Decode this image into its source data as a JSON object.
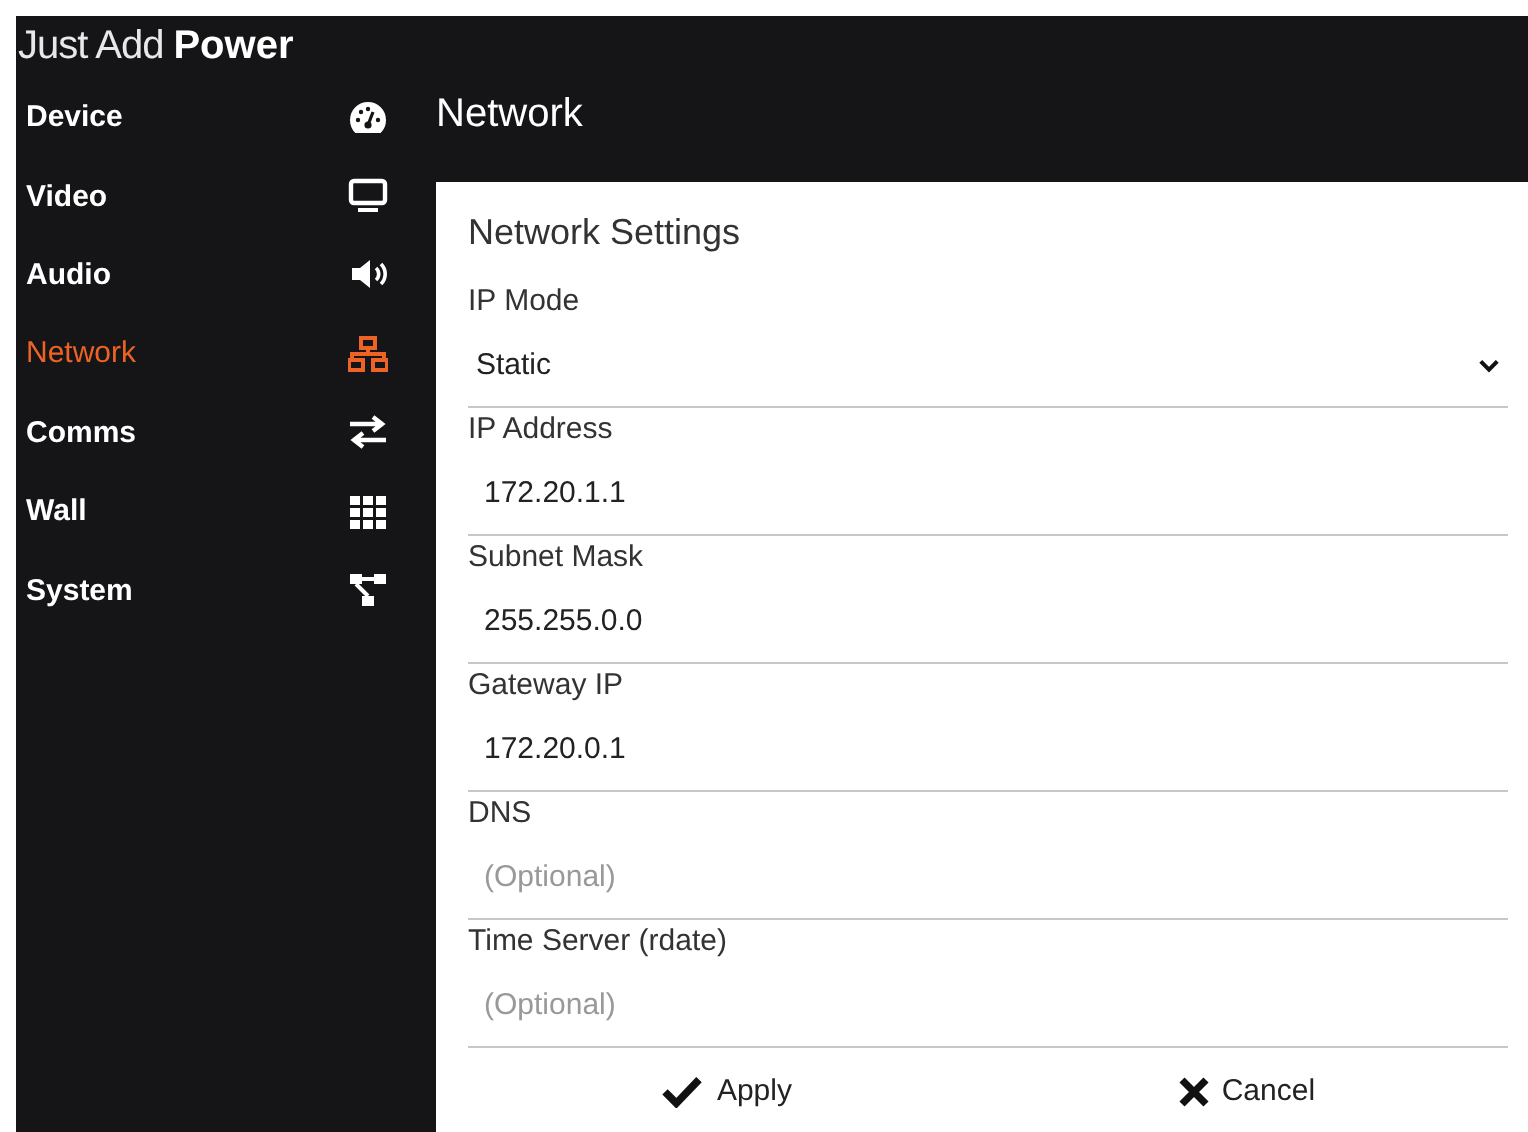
{
  "brand": {
    "light": "Just Add",
    "bold": "Power"
  },
  "sidebar": {
    "items": [
      {
        "label": "Device",
        "kind": "gauge",
        "selected": false
      },
      {
        "label": "Video",
        "kind": "monitor",
        "selected": false
      },
      {
        "label": "Audio",
        "kind": "speaker",
        "selected": false
      },
      {
        "label": "Network",
        "kind": "network",
        "selected": true
      },
      {
        "label": "Comms",
        "kind": "swap",
        "selected": false
      },
      {
        "label": "Wall",
        "kind": "grid",
        "selected": false
      },
      {
        "label": "System",
        "kind": "tree",
        "selected": false
      }
    ]
  },
  "page_title": "Network",
  "card": {
    "title": "Network Settings",
    "fields": [
      {
        "kind": "select",
        "label": "IP Mode",
        "value": "Static"
      },
      {
        "kind": "input",
        "label": "IP Address",
        "value": "172.20.1.1"
      },
      {
        "kind": "input",
        "label": "Subnet Mask",
        "value": "255.255.0.0"
      },
      {
        "kind": "input",
        "label": "Gateway IP",
        "value": "172.20.0.1"
      },
      {
        "kind": "input",
        "label": "DNS",
        "placeholder": "(Optional)"
      },
      {
        "kind": "input",
        "label": "Time Server (rdate)",
        "placeholder": "(Optional)"
      }
    ],
    "buttons": [
      {
        "kind": "apply",
        "label": "Apply"
      },
      {
        "kind": "cancel",
        "label": "Cancel"
      }
    ]
  }
}
